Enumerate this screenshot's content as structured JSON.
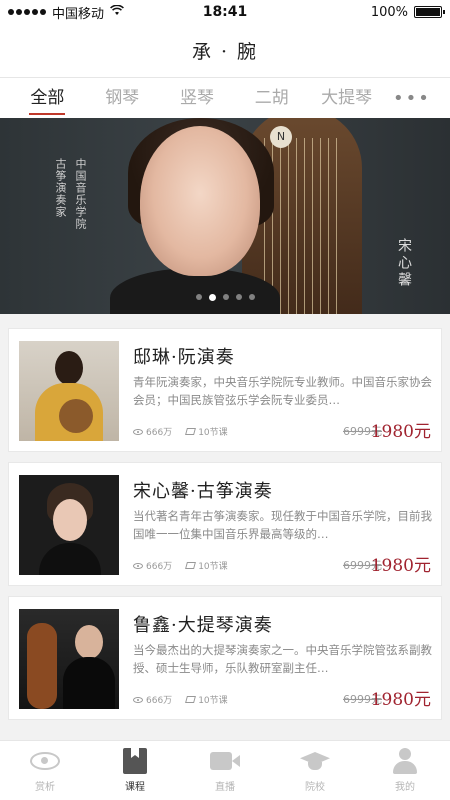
{
  "status_bar": {
    "carrier": "中国移动",
    "time": "18:41",
    "battery_percent": "100%",
    "battery_level": 1.0
  },
  "header": {
    "title": "承 · 腕"
  },
  "tabs": [
    {
      "label": "全部",
      "active": true
    },
    {
      "label": "钢琴",
      "active": false
    },
    {
      "label": "竖琴",
      "active": false
    },
    {
      "label": "二胡",
      "active": false
    },
    {
      "label": "大提琴",
      "active": false
    }
  ],
  "tabs_more": "•••",
  "banner": {
    "left_text_1": "中国音乐学院",
    "left_text_2": "古筝演奏家",
    "right_text": "宋心馨",
    "logo_text": "N",
    "dots_count": 5,
    "active_dot": 1
  },
  "courses": [
    {
      "title": "邸琳·阮演奏",
      "desc": "青年阮演奏家，中央音乐学院阮专业教师。中国音乐家协会会员；中国民族管弦乐学会阮专业委员…",
      "views": "666万",
      "lessons": "10节课",
      "old_price": "6999元",
      "price": "1980元"
    },
    {
      "title": "宋心馨·古筝演奏",
      "desc": "当代著名青年古筝演奏家。现任教于中国音乐学院，目前我国唯一一位集中国音乐界最高等级的…",
      "views": "666万",
      "lessons": "10节课",
      "old_price": "6999元",
      "price": "1980元"
    },
    {
      "title": "鲁鑫·大提琴演奏",
      "desc": "当今最杰出的大提琴演奏家之一。中央音乐学院管弦系副教授、硕士生导师，乐队教研室副主任…",
      "views": "666万",
      "lessons": "10节课",
      "old_price": "6999元",
      "price": "1980元"
    }
  ],
  "bottom_nav": [
    {
      "label": "赏析",
      "icon": "eye-icon",
      "active": false
    },
    {
      "label": "课程",
      "icon": "bookmark-icon",
      "active": true
    },
    {
      "label": "直播",
      "icon": "video-camera-icon",
      "active": false
    },
    {
      "label": "院校",
      "icon": "graduation-cap-icon",
      "active": false
    },
    {
      "label": "我的",
      "icon": "user-icon",
      "active": false
    }
  ],
  "colors": {
    "accent_red": "#a0232f",
    "tab_underline": "#c0392b",
    "banner_bg": "#2e3437"
  }
}
